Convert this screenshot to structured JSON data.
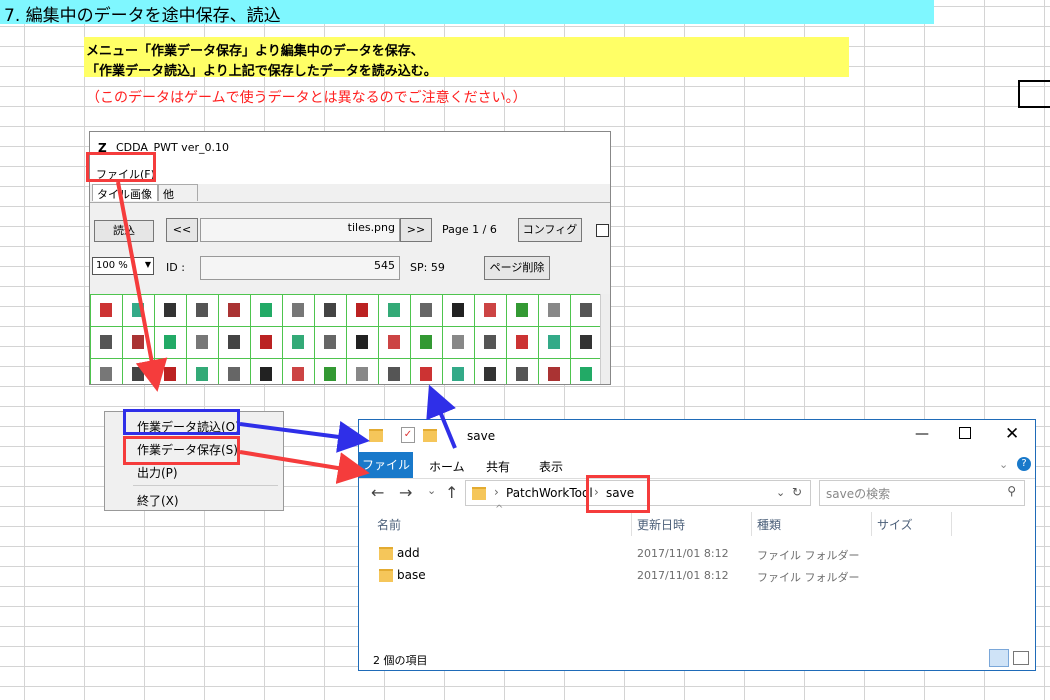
{
  "sheet": {
    "title": "7. 編集中のデータを途中保存、読込",
    "instruction_1": "メニュー「作業データ保存」より編集中のデータを保存、",
    "instruction_2": "「作業データ読込」より上記で保存したデータを読み込む。",
    "note": "（このデータはゲームで使うデータとは異なるのでご注意ください。）"
  },
  "app": {
    "logo": "Z",
    "title": "CDDA_PWT  ver_0.10",
    "menu_file": "ファイル(F)",
    "tabs": [
      "タイル画像",
      "他"
    ],
    "load_button": "読込",
    "prev_button": "<<",
    "filename": "tiles.png",
    "next_button": ">>",
    "page_label": "Page 1 / 6",
    "config_button": "コンフィグ",
    "zoom": "100 %",
    "id_label": "ID :",
    "id_value": "545",
    "sp_label": "SP: 59",
    "delete_page_button": "ページ削除"
  },
  "context_menu": {
    "items": [
      "作業データ読込(O)",
      "作業データ保存(S)",
      "出力(P)",
      "終了(X)"
    ]
  },
  "explorer": {
    "window_title": "save",
    "ribbon_tabs": [
      "ファイル",
      "ホーム",
      "共有",
      "表示"
    ],
    "path_parent": "PatchWorkTool",
    "path_current": "save",
    "search_placeholder": "saveの検索",
    "columns": [
      "名前",
      "更新日時",
      "種類",
      "サイズ"
    ],
    "files": [
      {
        "name": "add",
        "modified": "2017/11/01 8:12",
        "type": "ファイル フォルダー"
      },
      {
        "name": "base",
        "modified": "2017/11/01 8:12",
        "type": "ファイル フォルダー"
      }
    ],
    "status": "2 個の項目"
  },
  "colors": {
    "header_band": "#7ff7ff",
    "highlight": "#ffff66",
    "note_red": "#ff2020",
    "callout_red": "#f53c3c",
    "callout_blue": "#2f2fe8",
    "accent": "#1979ca"
  }
}
